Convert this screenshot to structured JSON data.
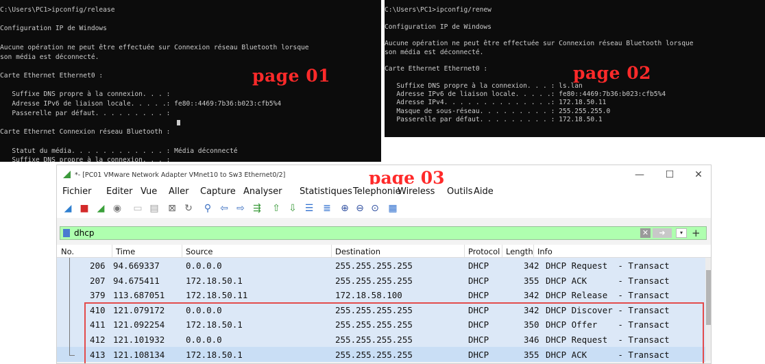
{
  "terminal1": {
    "lines": [
      "C:\\Users\\PC1>ipconfig/release",
      "",
      "Configuration IP de Windows",
      "",
      "Aucune opération ne peut être effectuée sur Connexion réseau Bluetooth lorsque",
      "son média est déconnecté.",
      "",
      "Carte Ethernet Ethernet0 :",
      "",
      "   Suffixe DNS propre à la connexion. . . :",
      "   Adresse IPv6 de liaison locale. . . . .: fe80::4469:7b36:b023:cfb5%4",
      "   Passerelle par défaut. . . . . . . . . :",
      "",
      "Carte Ethernet Connexion réseau Bluetooth :",
      "",
      "   Statut du média. . . . . . . . . . . . : Média déconnecté",
      "   Suffixe DNS propre à la connexion. . . :"
    ],
    "label": "page 01"
  },
  "terminal2": {
    "lines": [
      "C:\\Users\\PC1>ipconfig/renew",
      "",
      "Configuration IP de Windows",
      "",
      "Aucune opération ne peut être effectuée sur Connexion réseau Bluetooth lorsque",
      "son média est déconnecté.",
      "",
      "Carte Ethernet Ethernet0 :",
      "",
      "   Suffixe DNS propre à la connexion. . . : ls.lan",
      "   Adresse IPv6 de liaison locale. . . . .: fe80::4469:7b36:b023:cfb5%4",
      "   Adresse IPv4. . . . . . . . . . . . . .: 172.18.50.11",
      "   Masque de sous-réseau. . . . . . . . . : 255.255.255.0",
      "   Passerelle par défaut. . . . . . . . . : 172.18.50.1"
    ],
    "label": "page 02"
  },
  "wireshark": {
    "title": "*- [PC01 VMware Network Adapter VMnet10 to Sw3 Ethernet0/2]",
    "label": "page 03",
    "window_controls": {
      "minimize": "—",
      "maximize": "☐",
      "close": "✕"
    },
    "menu": [
      "Fichier",
      "Editer",
      "Vue",
      "Aller",
      "Capture",
      "Analyser",
      "Statistiques",
      "Telephonie",
      "Wireless",
      "Outils",
      "Aide"
    ],
    "toolbar_icons": [
      "shark-fin-icon",
      "stop-capture-icon",
      "restart-capture-icon",
      "capture-options-icon",
      "open-file-icon",
      "save-file-icon",
      "close-file-icon",
      "reload-file-icon",
      "find-packet-icon",
      "go-back-icon",
      "go-forward-icon",
      "go-to-packet-icon",
      "go-first-icon",
      "go-last-icon",
      "autoscroll-icon",
      "colorize-icon",
      "zoom-in-icon",
      "zoom-out-icon",
      "zoom-normal-icon",
      "resize-columns-icon"
    ],
    "filter": {
      "value": "dhcp"
    },
    "columns": [
      "No.",
      "Time",
      "Source",
      "Destination",
      "Protocol",
      "Length",
      "Info"
    ],
    "packets": [
      {
        "no": "206",
        "time": "94.669337",
        "source": "0.0.0.0",
        "destination": "255.255.255.255",
        "protocol": "DHCP",
        "length": "342",
        "info": "DHCP Request  - Transact"
      },
      {
        "no": "207",
        "time": "94.675411",
        "source": "172.18.50.1",
        "destination": "255.255.255.255",
        "protocol": "DHCP",
        "length": "355",
        "info": "DHCP ACK      - Transact"
      },
      {
        "no": "379",
        "time": "113.687051",
        "source": "172.18.50.11",
        "destination": "172.18.58.100",
        "protocol": "DHCP",
        "length": "342",
        "info": "DHCP Release  - Transact"
      },
      {
        "no": "410",
        "time": "121.079172",
        "source": "0.0.0.0",
        "destination": "255.255.255.255",
        "protocol": "DHCP",
        "length": "342",
        "info": "DHCP Discover - Transact"
      },
      {
        "no": "411",
        "time": "121.092254",
        "source": "172.18.50.1",
        "destination": "255.255.255.255",
        "protocol": "DHCP",
        "length": "350",
        "info": "DHCP Offer    - Transact"
      },
      {
        "no": "412",
        "time": "121.101932",
        "source": "0.0.0.0",
        "destination": "255.255.255.255",
        "protocol": "DHCP",
        "length": "346",
        "info": "DHCP Request  - Transact"
      },
      {
        "no": "413",
        "time": "121.108134",
        "source": "172.18.50.1",
        "destination": "255.255.255.255",
        "protocol": "DHCP",
        "length": "355",
        "info": "DHCP ACK      - Transact"
      }
    ],
    "selected_row": 6,
    "colors": {
      "filter_bg": "#afffaf",
      "row_bg": "#dce8f7",
      "highlight_border": "#e34b4b",
      "label_red": "#ff2a2a"
    }
  }
}
